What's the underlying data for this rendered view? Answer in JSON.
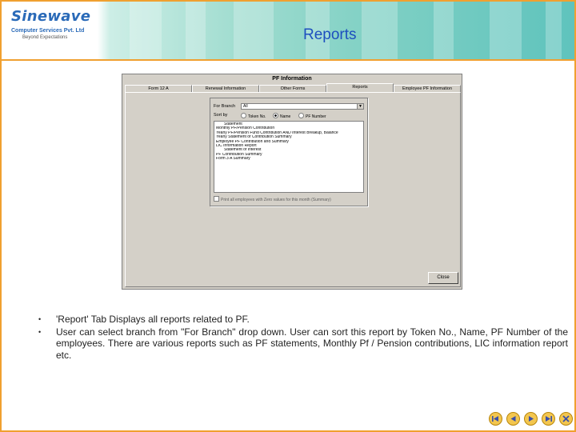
{
  "header": {
    "logo_name": "Sinewave",
    "logo_sub": "Computer Services Pvt. Ltd",
    "logo_tag": "Beyond Expectations",
    "title": "Reports"
  },
  "window": {
    "title": "PF Information",
    "tabs": [
      {
        "label": "Form 12 A"
      },
      {
        "label": "Renewal Information"
      },
      {
        "label": "Other Forms"
      },
      {
        "label": "Reports"
      },
      {
        "label": "Employee PF Information"
      }
    ],
    "active_tab": 3,
    "branch_label": "For Branch",
    "branch_value": "All",
    "sort_label": "Sort by",
    "sort_options": [
      "Token No.",
      "Name",
      "PF Number"
    ],
    "sort_selected": 1,
    "reports": [
      "Statement",
      "Monthly PF/Pension Contribution",
      "Yearly PF/Pension Fund Contribution AND Interest Breakup, Balance",
      "Yearly Statement of Contribution Summary",
      "Employee PF Contribution and Summary",
      "LIC Information Report",
      "Statement of Interest",
      "PF Contribution Summary",
      "Form 3 A Summary"
    ],
    "check_label": "Print all employees with Zero values for this month (Summary)",
    "close_label": "Close"
  },
  "bullets": [
    "'Report' Tab Displays all reports related to PF.",
    "User can select branch from \"For Branch\" drop down. User can sort this report by Token No., Name, PF Number of the employees. There are various reports such as PF statements, Monthly Pf / Pension contributions, LIC information report etc."
  ],
  "bullet_glyph": "•",
  "colors": {
    "border": "#f0a030",
    "title": "#1d4fbf",
    "nav": "#f3c64f"
  }
}
